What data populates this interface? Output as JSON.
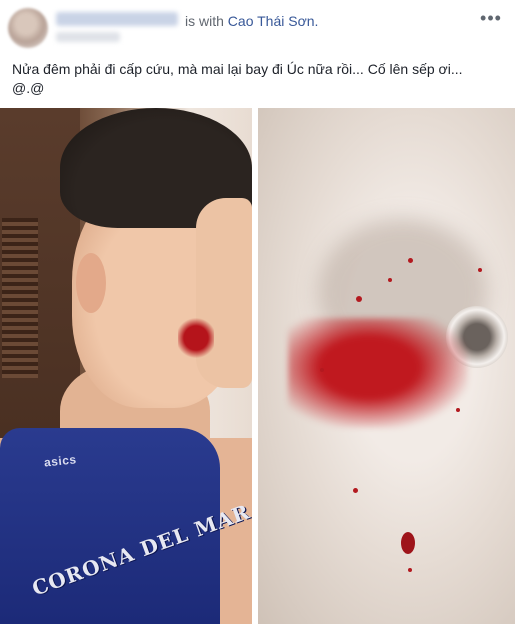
{
  "post": {
    "author_name": "Cao Thái Sơn (obscured)",
    "with_text": "is with",
    "tagged_person": "Cao Thái Sơn.",
    "more_icon": "•••",
    "caption": "Nửa đêm phải đi cấp cứu, mà mai lại bay đi Úc nữa rồi... Cố lên sếp ơi...\n@.@",
    "photos": [
      {
        "brand": "asics",
        "jersey_text": "CORONA DEL MAR"
      },
      {}
    ]
  }
}
